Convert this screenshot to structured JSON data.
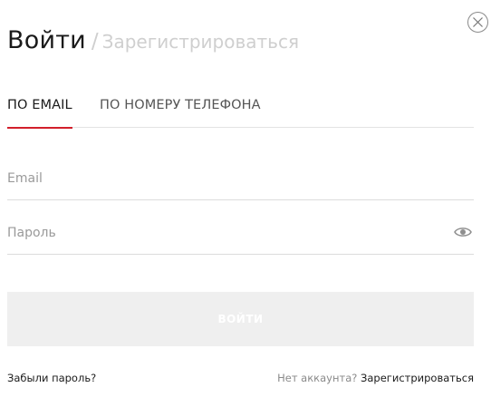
{
  "header": {
    "login_title": "Войти",
    "separator": "/",
    "register_title": "Зарегистрироваться"
  },
  "tabs": [
    {
      "label": "ПО EMAIL",
      "active": true
    },
    {
      "label": "ПО НОМЕРУ ТЕЛЕФОНА",
      "active": false
    }
  ],
  "form": {
    "email": {
      "value": "",
      "placeholder": "Email"
    },
    "password": {
      "value": "",
      "placeholder": "Пароль"
    },
    "submit_label": "ВОЙТИ"
  },
  "footer": {
    "forgot_label": "Забыли пароль?",
    "no_account_text": "Нет аккаунта?",
    "register_link": "Зарегистрироваться"
  },
  "icons": {
    "close": "close-icon",
    "eye": "eye-icon"
  },
  "colors": {
    "accent": "#d21f2b",
    "button_bg": "#efefef",
    "muted_text": "#cfcfcf"
  }
}
